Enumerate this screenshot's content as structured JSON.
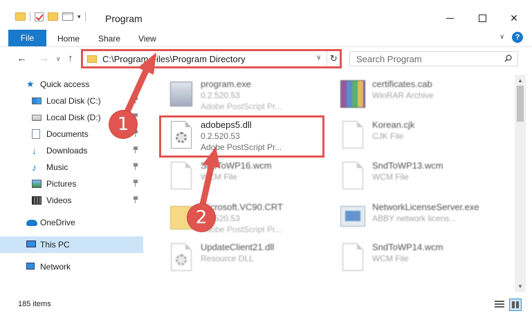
{
  "window": {
    "title": "Program"
  },
  "ribbon": {
    "file_label": "File",
    "tabs": [
      "Home",
      "Share",
      "View"
    ],
    "help": "?"
  },
  "nav": {
    "address": "C:\\Program Files\\Program Directory",
    "refresh_glyph": "↻",
    "search_placeholder": "Search Program"
  },
  "sidebar": {
    "items": [
      {
        "label": "Quick access",
        "icon": "star-icon"
      },
      {
        "label": "Local Disk (C:)",
        "icon": "drive-icon",
        "pinned": true
      },
      {
        "label": "Local Disk (D:)",
        "icon": "drive-icon",
        "pinned": true
      },
      {
        "label": "Documents",
        "icon": "documents-icon",
        "pinned": true
      },
      {
        "label": "Downloads",
        "icon": "downloads-icon",
        "pinned": true
      },
      {
        "label": "Music",
        "icon": "music-icon",
        "pinned": true
      },
      {
        "label": "Pictures",
        "icon": "pictures-icon",
        "pinned": true
      },
      {
        "label": "Videos",
        "icon": "videos-icon",
        "pinned": true
      },
      {
        "label": "OneDrive",
        "icon": "onedrive-icon"
      },
      {
        "label": "This PC",
        "icon": "pc-icon",
        "active": true
      },
      {
        "label": "Network",
        "icon": "network-icon"
      }
    ]
  },
  "files": [
    {
      "name": "program.exe",
      "line2": "0.2.520.53",
      "line3": "Adobe PostScript Pr...",
      "icon": "exe-icon"
    },
    {
      "name": "certificates.cab",
      "line2": "WinRAR Archive",
      "line3": "",
      "icon": "archive-icon"
    },
    {
      "name": "adobeps5.dll",
      "line2": "0.2.520.53",
      "line3": "Adobe PostScript Pr...",
      "icon": "dll-icon",
      "highlighted": true
    },
    {
      "name": "Korean.cjk",
      "line2": "CJK File",
      "line3": "",
      "icon": "file-icon"
    },
    {
      "name": "SndToWP16.wcm",
      "line2": "WCM File",
      "line3": "",
      "icon": "file-icon"
    },
    {
      "name": "SndToWP13.wcm",
      "line2": "WCM File",
      "line3": "",
      "icon": "file-icon"
    },
    {
      "name": "Microsoft.VC90.CRT",
      "line2": "0.2.520.53",
      "line3": "Adobe PostScript Pr...",
      "icon": "folder-icon"
    },
    {
      "name": "NetworkLicenseServer.exe",
      "line2": "ABBY network licens...",
      "line3": "",
      "icon": "network-exe-icon"
    },
    {
      "name": "UpdateClient21.dll",
      "line2": "Resource DLL",
      "line3": "",
      "icon": "dll-icon"
    },
    {
      "name": "SndToWP14.wcm",
      "line2": "WCM File",
      "line3": "",
      "icon": "file-icon"
    }
  ],
  "status": {
    "count": "185 items"
  },
  "callouts": {
    "one": "1",
    "two": "2"
  },
  "colors": {
    "accent": "#1979ca",
    "highlight": "#e0554f",
    "selected": "#cce4f7"
  }
}
